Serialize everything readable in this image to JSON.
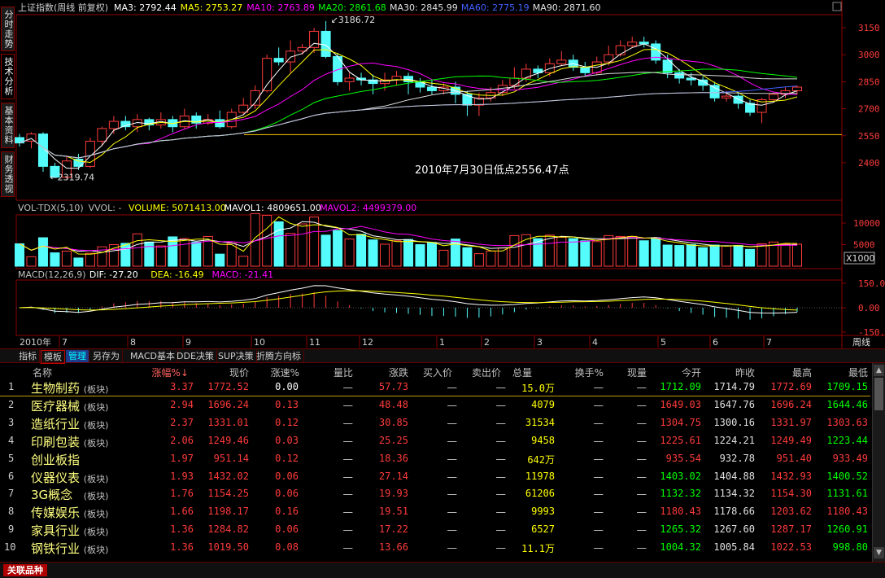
{
  "kline": {
    "title": "上证指数(周线 前复权)",
    "ma": [
      {
        "label": "MA3: 2792.44",
        "color": "#ffffff"
      },
      {
        "label": "MA5: 2753.27",
        "color": "#ffff00"
      },
      {
        "label": "MA10: 2763.89",
        "color": "#ff00ff"
      },
      {
        "label": "MA20: 2861.68",
        "color": "#00ff00"
      },
      {
        "label": "MA30: 2845.99",
        "color": "#e0e0e0"
      },
      {
        "label": "MA60: 2775.19",
        "color": "#4060ff"
      },
      {
        "label": "MA90: 2871.60",
        "color": "#e0e0e0"
      }
    ],
    "high_label": "3186.72",
    "low_label": "2319.74",
    "annotation": "2010年7月30日低点2556.47点",
    "yticks": [
      "3150",
      "3000",
      "2850",
      "2700",
      "2550",
      "2400"
    ]
  },
  "volume": {
    "labels": [
      {
        "text": "VOL-TDX(5,10)",
        "color": "#c0c0c0"
      },
      {
        "text": "VVOL: -",
        "color": "#c0c0c0"
      },
      {
        "text": "VOLUME: 5071413.00",
        "color": "#ffff00"
      },
      {
        "text": "MAVOL1: 4809651.00",
        "color": "#ffffff"
      },
      {
        "text": "MAVOL2: 4499379.00",
        "color": "#ff00ff"
      }
    ],
    "yticks": [
      "10000",
      "5000"
    ],
    "unit": "X1000"
  },
  "macd": {
    "labels": [
      {
        "text": "MACD(12,26,9)",
        "color": "#c0c0c0"
      },
      {
        "text": "DIF: -27.20",
        "color": "#ffffff"
      },
      {
        "text": "DEA: -16.49",
        "color": "#ffff00"
      },
      {
        "text": "MACD: -21.41",
        "color": "#ff00ff"
      }
    ],
    "yticks": [
      "150.00",
      "0.00",
      "-150.00"
    ]
  },
  "xaxis": {
    "labels": [
      "2010年",
      "7",
      "8",
      "9",
      "10",
      "11",
      "12",
      "1",
      "2",
      "3",
      "4",
      "5",
      "6",
      "7"
    ],
    "period": "周线"
  },
  "side_tabs": [
    "分时走势",
    "技术分析",
    "基本资料",
    "财务透视"
  ],
  "toolbar": [
    "指标",
    "模板",
    "管理",
    "另存为",
    "MACD基本",
    "DDE决策",
    "SUP决策",
    "折腾方向标"
  ],
  "pm": [
    "+",
    "-"
  ],
  "table": {
    "headers": [
      "名称",
      "涨幅%↓",
      "现价",
      "涨速%",
      "量比",
      "涨跌",
      "买入价",
      "卖出价",
      "总量",
      "换手%",
      "现量",
      "今开",
      "昨收",
      "最高",
      "最低"
    ],
    "rows": [
      {
        "no": "1",
        "name": "生物制药",
        "tag": "(板块)",
        "chg": "3.37",
        "price": "1772.52",
        "speed": "0.00",
        "vr": "—",
        "diff": "57.73",
        "bid": "—",
        "ask": "—",
        "vol": "15.0万",
        "turn": "—",
        "cur": "—",
        "open": "1712.09",
        "prev": "1714.79",
        "high": "1772.69",
        "low": "1709.15"
      },
      {
        "no": "2",
        "name": "医疗器械",
        "tag": "(板块)",
        "chg": "2.94",
        "price": "1696.24",
        "speed": "0.13",
        "vr": "—",
        "diff": "48.48",
        "bid": "—",
        "ask": "—",
        "vol": "4079",
        "turn": "—",
        "cur": "—",
        "open": "1649.03",
        "prev": "1647.76",
        "high": "1696.24",
        "low": "1644.46"
      },
      {
        "no": "3",
        "name": "造纸行业",
        "tag": "(板块)",
        "chg": "2.37",
        "price": "1331.01",
        "speed": "0.12",
        "vr": "—",
        "diff": "30.85",
        "bid": "—",
        "ask": "—",
        "vol": "31534",
        "turn": "—",
        "cur": "—",
        "open": "1304.75",
        "prev": "1300.16",
        "high": "1331.97",
        "low": "1303.63"
      },
      {
        "no": "4",
        "name": "印刷包装",
        "tag": "(板块)",
        "chg": "2.06",
        "price": "1249.46",
        "speed": "0.03",
        "vr": "—",
        "diff": "25.25",
        "bid": "—",
        "ask": "—",
        "vol": "9458",
        "turn": "—",
        "cur": "—",
        "open": "1225.61",
        "prev": "1224.21",
        "high": "1249.49",
        "low": "1223.44"
      },
      {
        "no": "5",
        "name": "创业板指",
        "tag": "",
        "chg": "1.97",
        "price": "951.14",
        "speed": "0.12",
        "vr": "—",
        "diff": "18.36",
        "bid": "—",
        "ask": "—",
        "vol": "642万",
        "turn": "—",
        "cur": "—",
        "open": "935.54",
        "prev": "932.78",
        "high": "951.40",
        "low": "933.49"
      },
      {
        "no": "6",
        "name": "仪器仪表",
        "tag": "(板块)",
        "chg": "1.93",
        "price": "1432.02",
        "speed": "0.06",
        "vr": "—",
        "diff": "27.14",
        "bid": "—",
        "ask": "—",
        "vol": "11978",
        "turn": "—",
        "cur": "—",
        "open": "1403.02",
        "prev": "1404.88",
        "high": "1432.93",
        "low": "1400.52"
      },
      {
        "no": "7",
        "name": "3G概念",
        "tag": "(板块)",
        "chg": "1.76",
        "price": "1154.25",
        "speed": "0.06",
        "vr": "—",
        "diff": "19.93",
        "bid": "—",
        "ask": "—",
        "vol": "61206",
        "turn": "—",
        "cur": "—",
        "open": "1132.32",
        "prev": "1134.32",
        "high": "1154.30",
        "low": "1131.61"
      },
      {
        "no": "8",
        "name": "传媒娱乐",
        "tag": "(板块)",
        "chg": "1.66",
        "price": "1198.17",
        "speed": "0.16",
        "vr": "—",
        "diff": "19.51",
        "bid": "—",
        "ask": "—",
        "vol": "9993",
        "turn": "—",
        "cur": "—",
        "open": "1180.43",
        "prev": "1178.66",
        "high": "1203.62",
        "low": "1180.43"
      },
      {
        "no": "9",
        "name": "家具行业",
        "tag": "(板块)",
        "chg": "1.36",
        "price": "1284.82",
        "speed": "0.06",
        "vr": "—",
        "diff": "17.22",
        "bid": "—",
        "ask": "—",
        "vol": "6527",
        "turn": "—",
        "cur": "—",
        "open": "1265.32",
        "prev": "1267.60",
        "high": "1287.17",
        "low": "1260.91"
      },
      {
        "no": "10",
        "name": "钢铁行业",
        "tag": "(板块)",
        "chg": "1.36",
        "price": "1019.50",
        "speed": "0.08",
        "vr": "—",
        "diff": "13.66",
        "bid": "—",
        "ask": "—",
        "vol": "11.1万",
        "turn": "—",
        "cur": "—",
        "open": "1004.32",
        "prev": "1005.84",
        "high": "1022.53",
        "low": "998.80"
      }
    ]
  },
  "status": {
    "label": "关联品种"
  },
  "colors": {
    "up": "#ff3b3b",
    "down": "#00ff00",
    "flat": "#ffffff",
    "cyan": "#54fcfc",
    "vol": "#ffff00",
    "grid": "#8b0000"
  },
  "chart_data": {
    "type": "candlestick",
    "title": "上证指数(周线 前复权)",
    "ylim": [
      2319.74,
      3186.72
    ],
    "candles": [
      [
        2540,
        2510,
        2560,
        2490
      ],
      [
        2520,
        2560,
        2570,
        2480
      ],
      [
        2560,
        2380,
        2570,
        2350
      ],
      [
        2380,
        2320,
        2400,
        2319.74
      ],
      [
        2320,
        2410,
        2440,
        2310
      ],
      [
        2420,
        2380,
        2450,
        2360
      ],
      [
        2380,
        2520,
        2540,
        2370
      ],
      [
        2520,
        2590,
        2600,
        2500
      ],
      [
        2590,
        2630,
        2660,
        2560
      ],
      [
        2630,
        2600,
        2660,
        2580
      ],
      [
        2600,
        2640,
        2670,
        2570
      ],
      [
        2640,
        2610,
        2650,
        2580
      ],
      [
        2610,
        2640,
        2680,
        2590
      ],
      [
        2640,
        2600,
        2660,
        2570
      ],
      [
        2600,
        2660,
        2700,
        2590
      ],
      [
        2660,
        2620,
        2680,
        2590
      ],
      [
        2620,
        2640,
        2670,
        2610
      ],
      [
        2640,
        2600,
        2690,
        2590
      ],
      [
        2600,
        2680,
        2700,
        2590
      ],
      [
        2680,
        2720,
        2760,
        2670
      ],
      [
        2720,
        2800,
        2830,
        2700
      ],
      [
        2800,
        2980,
        3000,
        2790
      ],
      [
        2980,
        2960,
        3040,
        2940
      ],
      [
        2960,
        3020,
        3080,
        2900
      ],
      [
        3020,
        3040,
        3060,
        3000
      ],
      [
        3040,
        3130,
        3150,
        3010
      ],
      [
        3130,
        2990,
        3186.72,
        2980
      ],
      [
        2990,
        2850,
        3010,
        2830
      ],
      [
        2850,
        2870,
        2900,
        2800
      ],
      [
        2870,
        2860,
        2900,
        2830
      ],
      [
        2860,
        2840,
        2890,
        2780
      ],
      [
        2840,
        2860,
        2900,
        2800
      ],
      [
        2860,
        2880,
        2910,
        2830
      ],
      [
        2880,
        2850,
        2900,
        2780
      ],
      [
        2850,
        2820,
        2870,
        2790
      ],
      [
        2820,
        2800,
        2860,
        2780
      ],
      [
        2800,
        2820,
        2840,
        2780
      ],
      [
        2820,
        2780,
        2850,
        2730
      ],
      [
        2780,
        2720,
        2800,
        2660
      ],
      [
        2720,
        2760,
        2790,
        2660
      ],
      [
        2760,
        2790,
        2820,
        2740
      ],
      [
        2790,
        2830,
        2860,
        2770
      ],
      [
        2830,
        2870,
        2930,
        2810
      ],
      [
        2870,
        2920,
        2950,
        2850
      ],
      [
        2920,
        2900,
        2940,
        2870
      ],
      [
        2900,
        2950,
        2980,
        2880
      ],
      [
        2950,
        2970,
        3020,
        2940
      ],
      [
        2970,
        2930,
        3000,
        2910
      ],
      [
        2930,
        2900,
        2960,
        2880
      ],
      [
        2900,
        2960,
        2990,
        2890
      ],
      [
        2960,
        3000,
        3050,
        2940
      ],
      [
        3000,
        3050,
        3080,
        2990
      ],
      [
        3050,
        3070,
        3100,
        3040
      ],
      [
        3070,
        3060,
        3100,
        3040
      ],
      [
        3060,
        2970,
        3080,
        2950
      ],
      [
        2970,
        2900,
        3000,
        2870
      ],
      [
        2900,
        2870,
        2920,
        2840
      ],
      [
        2870,
        2860,
        2900,
        2830
      ],
      [
        2860,
        2830,
        2880,
        2800
      ],
      [
        2830,
        2760,
        2850,
        2740
      ],
      [
        2760,
        2770,
        2800,
        2740
      ],
      [
        2770,
        2730,
        2790,
        2700
      ],
      [
        2730,
        2680,
        2750,
        2660
      ],
      [
        2680,
        2750,
        2760,
        2620
      ],
      [
        2750,
        2780,
        2790,
        2740
      ],
      [
        2780,
        2800,
        2820,
        2760
      ],
      [
        2800,
        2820,
        2830,
        2780
      ]
    ],
    "volume": [
      5.2,
      2.2,
      6.6,
      3.1,
      3.5,
      1.9,
      3.0,
      4.5,
      5.0,
      5.3,
      7.5,
      5.6,
      4.7,
      6.8,
      6.4,
      5.6,
      6.9,
      2.8,
      5.3,
      2.3,
      12.2,
      11.8,
      10.3,
      7.6,
      9.8,
      11.4,
      7.2,
      8.3,
      6.3,
      7.4,
      6.1,
      5.1,
      5.9,
      6.2,
      5.0,
      5.5,
      3.7,
      6.3,
      4.3,
      2.9,
      3.5,
      4.2,
      7.1,
      7.3,
      6.4,
      7.2,
      6.7,
      6.4,
      5.9,
      5.7,
      7.1,
      6.9,
      6.9,
      5.9,
      6.6,
      4.9,
      4.8,
      5.0,
      4.3,
      4.9,
      4.7,
      4.8,
      3.9,
      5.2,
      5.6,
      5.1,
      5.1
    ],
    "volume_unit": "X1000"
  }
}
